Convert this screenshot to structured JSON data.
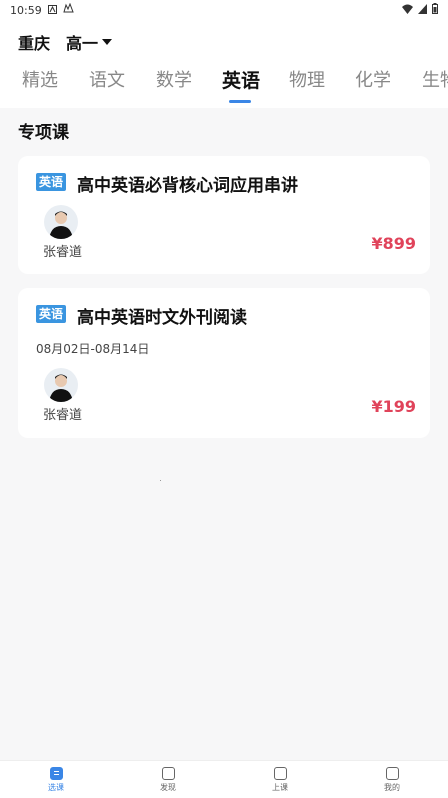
{
  "status": {
    "time": "10:59"
  },
  "header": {
    "city": "重庆",
    "grade": "高一"
  },
  "tabs": [
    {
      "label": "精选"
    },
    {
      "label": "语文"
    },
    {
      "label": "数学"
    },
    {
      "label": "英语"
    },
    {
      "label": "物理"
    },
    {
      "label": "化学"
    },
    {
      "label": "生物"
    }
  ],
  "active_tab": "英语",
  "section": {
    "title": "专项课"
  },
  "courses": [
    {
      "tag": "英语",
      "title": "高中英语必背核心词应用串讲",
      "date": "",
      "teacher": "张睿道",
      "price": "¥899"
    },
    {
      "tag": "英语",
      "title": "高中英语时文外刊阅读",
      "date": "08月02日-08月14日",
      "teacher": "张睿道",
      "price": "¥199"
    }
  ],
  "bottom_nav": [
    {
      "label": "选课",
      "icon": "course-icon"
    },
    {
      "label": "发现",
      "icon": "discover-icon"
    },
    {
      "label": "上课",
      "icon": "class-icon"
    },
    {
      "label": "我的",
      "icon": "profile-icon"
    }
  ],
  "colors": {
    "accent": "#3a86e6",
    "price": "#e0435a",
    "tag": "#3a95e0"
  }
}
